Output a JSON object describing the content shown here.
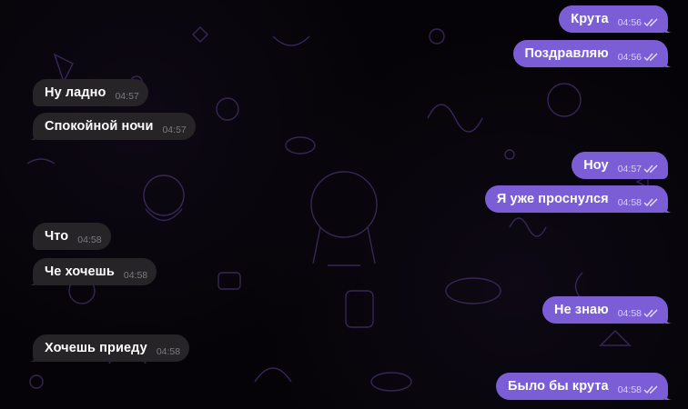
{
  "colors": {
    "outgoing_bubble": "#7b5ed6",
    "incoming_bubble": "#262427",
    "background": "#000000",
    "doodle": "#3b2a5c"
  },
  "messages": [
    {
      "direction": "out",
      "text": "Крута",
      "time": "04:56",
      "read": true
    },
    {
      "direction": "out",
      "text": "Поздравляю",
      "time": "04:56",
      "read": true
    },
    {
      "direction": "in",
      "text": "Ну ладно",
      "time": "04:57"
    },
    {
      "direction": "in",
      "text": "Спокойной ночи",
      "time": "04:57"
    },
    {
      "direction": "out",
      "text": "Ноу",
      "time": "04:57",
      "read": true
    },
    {
      "direction": "out",
      "text": "Я уже проснулся",
      "time": "04:58",
      "read": true
    },
    {
      "direction": "in",
      "text": "Что",
      "time": "04:58"
    },
    {
      "direction": "in",
      "text": "Че хочешь",
      "time": "04:58"
    },
    {
      "direction": "out",
      "text": "Не знаю",
      "time": "04:58",
      "read": true
    },
    {
      "direction": "in",
      "text": "Хочешь приеду",
      "time": "04:58"
    },
    {
      "direction": "out",
      "text": "Было бы крута",
      "time": "04:58",
      "read": true
    }
  ]
}
